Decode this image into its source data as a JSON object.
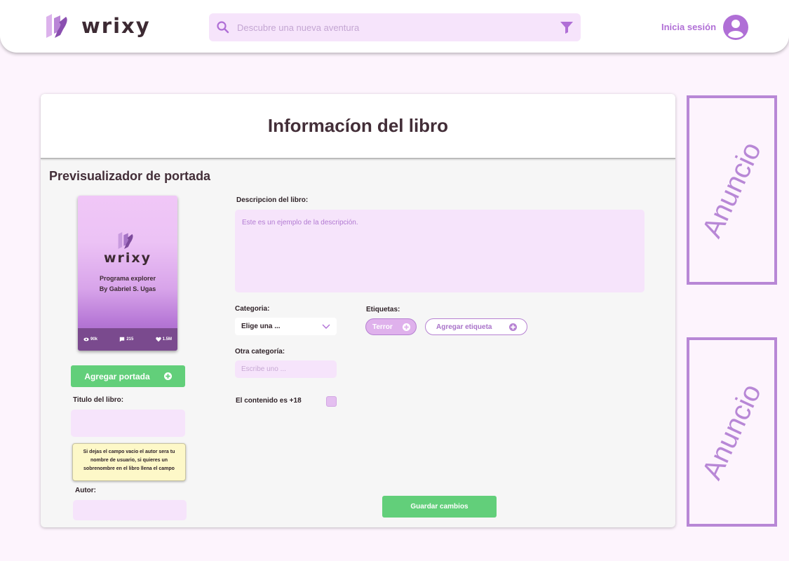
{
  "header": {
    "logo_text": "wrixy",
    "search_placeholder": "Descubre una nueva aventura",
    "login_label": "Inicia sesión"
  },
  "page": {
    "title": "Informacíon del libro"
  },
  "preview": {
    "title": "Previsualizador de portada",
    "cover": {
      "logo_text": "wrixy",
      "book_title": "Programa explorer",
      "author_line": "By Gabriel S. Ugas",
      "stats": {
        "views": "90k",
        "comments": "215",
        "likes": "1.5M"
      }
    },
    "add_cover_label": "Agregar portada"
  },
  "form": {
    "title_label": "Titulo del libro:",
    "title_value": "",
    "author_note": "Si dejas el campo vacio el autor sera tu nombre de usuario, si quieres un sobrenombre en el libro llena el campo",
    "author_label": "Autor:",
    "author_value": "",
    "description_label": "Descripcion del libro:",
    "description_placeholder": "Este es un ejemplo de la descripción.",
    "category_label": "Categoria:",
    "category_selected": "Elige una ...",
    "tags_label": "Etiquetas:",
    "tags": [
      "Terror"
    ],
    "add_tag_label": "Agregar etiqueta",
    "other_category_label": "Otra categoría:",
    "other_category_placeholder": "Escribe uno ...",
    "adult_label": "El contenido es +18",
    "adult_checked": false,
    "save_label": "Guardar cambios"
  },
  "ads": {
    "label_1": "Anuncio",
    "label_2": "Anuncio"
  },
  "colors": {
    "accent": "#b06fd6",
    "field_bg": "#f6e4fb",
    "green": "#62cf7a",
    "background": "#fdf4fd"
  }
}
